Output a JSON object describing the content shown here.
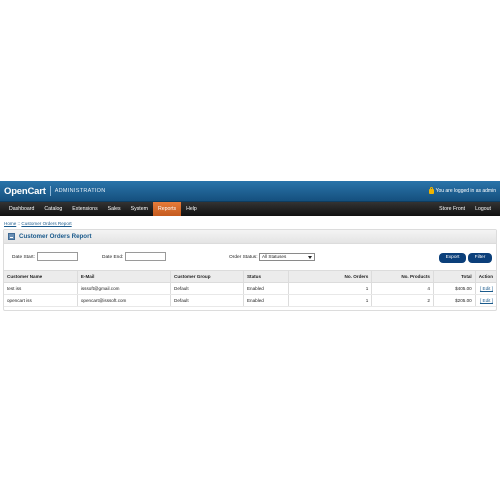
{
  "header": {
    "logo": "OpenCart",
    "admin_label": "ADMINISTRATION",
    "login_text": "You are logged in as admin"
  },
  "menu": {
    "items": [
      "Dashboard",
      "Catalog",
      "Extensions",
      "Sales",
      "System",
      "Reports",
      "Help"
    ],
    "right_items": [
      "Store Front",
      "Logout"
    ],
    "active": "Reports"
  },
  "breadcrumb": {
    "home": "Home",
    "separator": "::",
    "current": "Customer Orders Report"
  },
  "report": {
    "title": "Customer Orders Report",
    "date_start_label": "Date Start:",
    "date_start_value": "",
    "date_end_label": "Date End:",
    "date_end_value": "",
    "order_status_label": "Order Status:",
    "order_status_value": "All Statuses",
    "export_label": "Export",
    "filter_label": "Filter"
  },
  "table": {
    "columns": [
      "Customer Name",
      "E-Mail",
      "Customer Group",
      "Status",
      "No. Orders",
      "No. Products",
      "Total",
      "Action"
    ],
    "rows": [
      [
        "test iss",
        "isssoft@gmail.com",
        "Default",
        "Enabled",
        "1",
        "4",
        "$405.00",
        "[ Edit ]"
      ],
      [
        "opencart iss",
        "opencart@isssoft.com",
        "Default",
        "Enabled",
        "1",
        "2",
        "$205.00",
        "[ Edit ]"
      ]
    ]
  },
  "colors": {
    "header_blue": "#1a5a8c",
    "menu_active": "#d86a2a",
    "button_blue": "#0b3f7a"
  }
}
